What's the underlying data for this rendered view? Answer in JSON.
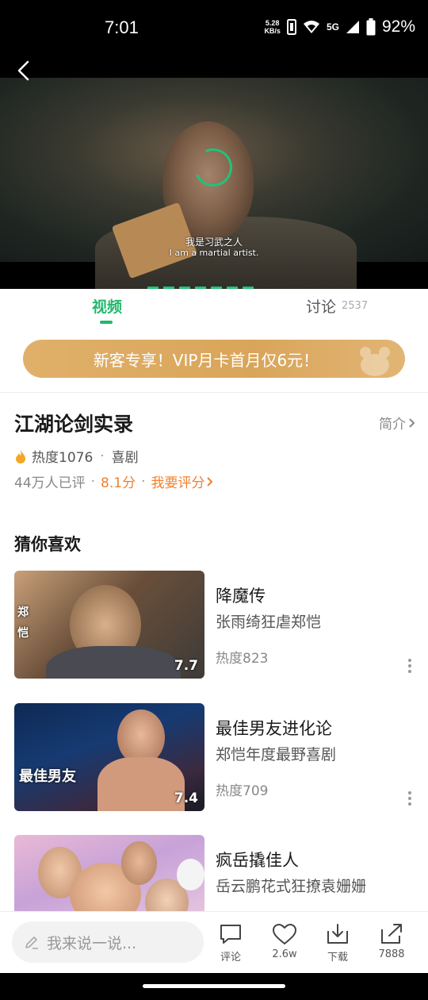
{
  "status": {
    "time": "7:01",
    "net_speed_line1": "5.28",
    "net_speed_line2": "KB/s",
    "network": "5G",
    "battery": "92%"
  },
  "player": {
    "subtitle_zh": "我是习武之人",
    "subtitle_en": "I am a martial artist."
  },
  "tabs": {
    "video": "视频",
    "discuss": "讨论",
    "discuss_count": "2537"
  },
  "vip_banner": "新客专享！VIP月卡首月仅6元！",
  "show": {
    "title": "江湖论剑实录",
    "intro": "简介",
    "heat": "热度1076",
    "genre": "喜剧",
    "ratings_count": "44万人已评",
    "score": "8.1分",
    "rate_cta": "我要评分"
  },
  "recommend": {
    "title": "猜你喜欢",
    "items": [
      {
        "title": "降魔传",
        "subtitle": "张雨绮狂虐郑恺",
        "heat": "热度823",
        "score": "7.7"
      },
      {
        "title": "最佳男友进化论",
        "subtitle": "郑恺年度最野喜剧",
        "heat": "热度709",
        "score": "7.4"
      },
      {
        "title": "疯岳撬佳人",
        "subtitle": "岳云鹏花式狂撩袁姗姗",
        "heat": "",
        "score": ""
      }
    ]
  },
  "bottom": {
    "input_placeholder": "我来说一说...",
    "comment_label": "评论",
    "like_label": "2.6w",
    "download_label": "下载",
    "share_label": "7888"
  },
  "colors": {
    "accent_green": "#21b86b",
    "accent_orange": "#f08030",
    "vip_gold": "#dcaa62"
  }
}
